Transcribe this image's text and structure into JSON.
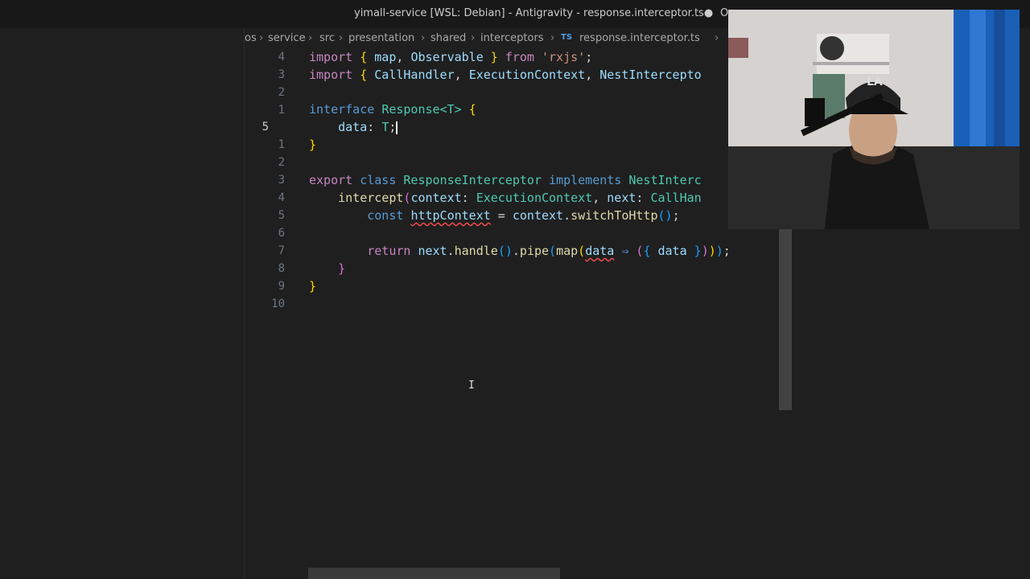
{
  "window": {
    "title": "yimall-service [WSL: Debian] - Antigravity - response.interceptor.ts●",
    "title_overflow": "O"
  },
  "breadcrumb": [
    {
      "label": "os"
    },
    {
      "label": "service"
    },
    {
      "label": "src"
    },
    {
      "label": "presentation"
    },
    {
      "label": "shared"
    },
    {
      "label": "interceptors"
    },
    {
      "label": "response.interceptor.ts",
      "badge": "TS"
    }
  ],
  "editor": {
    "line_numbers": [
      "4",
      "3",
      "2",
      "1",
      "5",
      "1",
      "2",
      "3",
      "4",
      "5",
      "6",
      "7",
      "8",
      "9",
      "10"
    ],
    "active_line_index": 4,
    "code": {
      "l1": {
        "t1": "import",
        "t2": "{",
        "t3": "map",
        "t4": ", ",
        "t5": "Observable",
        "t6": "}",
        "t7": "from",
        "t8": "'rxjs'",
        "t9": ";"
      },
      "l2": {
        "t1": "import",
        "t2": "{",
        "t3": "CallHandler",
        "t4": ", ",
        "t5": "ExecutionContext",
        "t6": ", ",
        "t7": "NestIntercepto"
      },
      "l4": {
        "t1": "interface",
        "t2": "Response",
        "t3": "<",
        "t4": "T",
        "t5": ">",
        "t6": "{"
      },
      "l5": {
        "t1": "data",
        "t2": ": ",
        "t3": "T",
        "t4": ";"
      },
      "l6": {
        "t1": "}"
      },
      "l8": {
        "t1": "export",
        "t2": "class",
        "t3": "ResponseInterceptor",
        "t4": "implements",
        "t5": "NestInterc"
      },
      "l9": {
        "t1": "intercept",
        "t2": "(",
        "t3": "context",
        "t4": ": ",
        "t5": "ExecutionContext",
        "t6": ", ",
        "t7": "next",
        "t8": ": ",
        "t9": "CallHan"
      },
      "l10": {
        "t1": "const",
        "t2": "httpContext",
        "t3": " = ",
        "t4": "context",
        "t5": ".",
        "t6": "switchToHttp",
        "t7": "()",
        "t8": ";"
      },
      "l12": {
        "t1": "return",
        "t2": "next",
        "t3": ".",
        "t4": "handle",
        "t5": "()",
        "t6": ".",
        "t7": "pipe",
        "t8": "(",
        "t9": "map",
        "t10": "(",
        "t11": "data",
        "t12": " ⇒ ",
        "t13": "(",
        "t14": "{",
        "t15": "data",
        "t16": "}",
        "t17": ")",
        "t18": ")",
        "t19": ")",
        "t20": ";"
      },
      "l13": {
        "t1": "}"
      },
      "l14": {
        "t1": "}"
      }
    }
  },
  "colors": {
    "keyword_blue": "#569cd6",
    "keyword_pink": "#c586c0",
    "type_teal": "#4ec9b0",
    "function_yellow": "#dcdcaa",
    "variable_blue": "#9cdcfe",
    "string_orange": "#ce9178",
    "bracket_gold": "#ffd700",
    "bracket_orchid": "#da70d6",
    "bracket_blue": "#179fff",
    "error_red": "#f14c4c"
  },
  "overlay": {
    "webcam": "webcam-feed",
    "cap_text": "LA"
  },
  "icons": {
    "mouse_cursor": "ibeam-cursor-icon"
  }
}
